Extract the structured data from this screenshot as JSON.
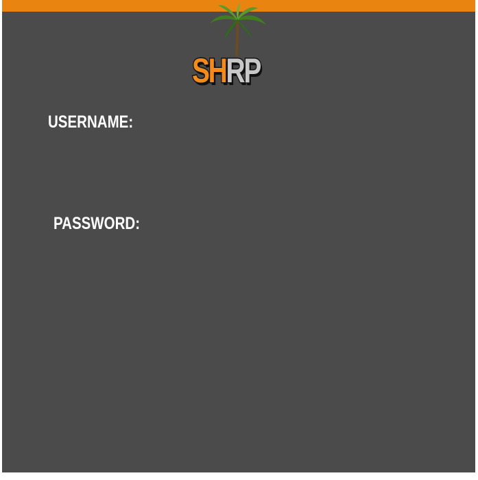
{
  "header": {
    "accent_color": "#e8840f",
    "background_color": "#4b4b4b"
  },
  "logo": {
    "text_primary": "SH",
    "text_secondary": "RP",
    "primary_color": "#f28a1c",
    "secondary_color": "#c8c8c8",
    "icon": "palm-tree-icon"
  },
  "login": {
    "username_label": "USERNAME:",
    "username_value": "",
    "password_label": "PASSWORD:",
    "password_value": ""
  }
}
